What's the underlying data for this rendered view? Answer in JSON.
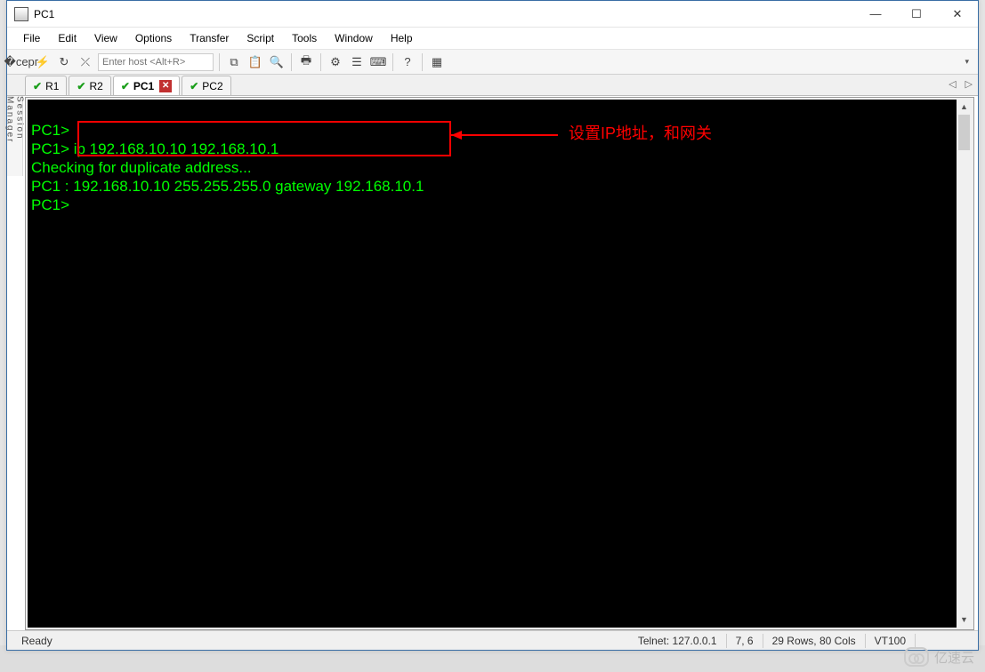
{
  "window": {
    "title": "PC1"
  },
  "menu": {
    "file": "File",
    "edit": "Edit",
    "view": "View",
    "options": "Options",
    "transfer": "Transfer",
    "script": "Script",
    "tools": "Tools",
    "window": "Window",
    "help": "Help"
  },
  "toolbar": {
    "host_placeholder": "Enter host <Alt+R>"
  },
  "tabs": [
    {
      "label": "R1",
      "active": false,
      "closeable": false
    },
    {
      "label": "R2",
      "active": false,
      "closeable": false
    },
    {
      "label": "PC1",
      "active": true,
      "closeable": true
    },
    {
      "label": "PC2",
      "active": false,
      "closeable": false
    }
  ],
  "sidebar": {
    "label": "Session Manager"
  },
  "terminal": {
    "lines": [
      "PC1>",
      "PC1> ip 192.168.10.10 192.168.10.1",
      "Checking for duplicate address...",
      "PC1 : 192.168.10.10 255.255.255.0 gateway 192.168.10.1",
      "",
      "PC1>"
    ]
  },
  "annotation": {
    "text": "设置IP地址，和网关"
  },
  "status": {
    "ready": "Ready",
    "conn": "Telnet: 127.0.0.1",
    "cursor": "7,  6",
    "size": "29 Rows, 80 Cols",
    "emul": "VT100"
  },
  "watermark": {
    "text": "亿速云"
  }
}
